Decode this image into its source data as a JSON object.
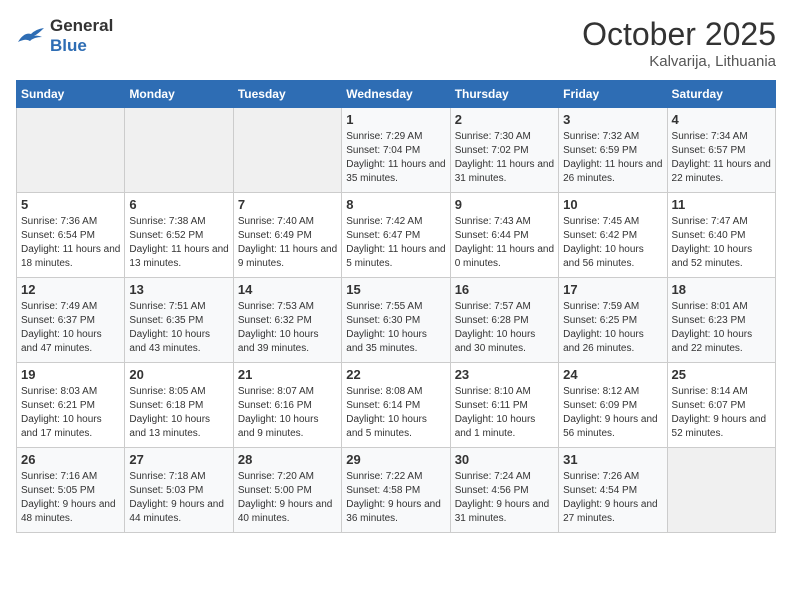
{
  "header": {
    "logo_general": "General",
    "logo_blue": "Blue",
    "month": "October 2025",
    "location": "Kalvarija, Lithuania"
  },
  "days_of_week": [
    "Sunday",
    "Monday",
    "Tuesday",
    "Wednesday",
    "Thursday",
    "Friday",
    "Saturday"
  ],
  "weeks": [
    [
      {
        "day": "",
        "sunrise": "",
        "sunset": "",
        "daylight": ""
      },
      {
        "day": "",
        "sunrise": "",
        "sunset": "",
        "daylight": ""
      },
      {
        "day": "",
        "sunrise": "",
        "sunset": "",
        "daylight": ""
      },
      {
        "day": "1",
        "sunrise": "Sunrise: 7:29 AM",
        "sunset": "Sunset: 7:04 PM",
        "daylight": "Daylight: 11 hours and 35 minutes."
      },
      {
        "day": "2",
        "sunrise": "Sunrise: 7:30 AM",
        "sunset": "Sunset: 7:02 PM",
        "daylight": "Daylight: 11 hours and 31 minutes."
      },
      {
        "day": "3",
        "sunrise": "Sunrise: 7:32 AM",
        "sunset": "Sunset: 6:59 PM",
        "daylight": "Daylight: 11 hours and 26 minutes."
      },
      {
        "day": "4",
        "sunrise": "Sunrise: 7:34 AM",
        "sunset": "Sunset: 6:57 PM",
        "daylight": "Daylight: 11 hours and 22 minutes."
      }
    ],
    [
      {
        "day": "5",
        "sunrise": "Sunrise: 7:36 AM",
        "sunset": "Sunset: 6:54 PM",
        "daylight": "Daylight: 11 hours and 18 minutes."
      },
      {
        "day": "6",
        "sunrise": "Sunrise: 7:38 AM",
        "sunset": "Sunset: 6:52 PM",
        "daylight": "Daylight: 11 hours and 13 minutes."
      },
      {
        "day": "7",
        "sunrise": "Sunrise: 7:40 AM",
        "sunset": "Sunset: 6:49 PM",
        "daylight": "Daylight: 11 hours and 9 minutes."
      },
      {
        "day": "8",
        "sunrise": "Sunrise: 7:42 AM",
        "sunset": "Sunset: 6:47 PM",
        "daylight": "Daylight: 11 hours and 5 minutes."
      },
      {
        "day": "9",
        "sunrise": "Sunrise: 7:43 AM",
        "sunset": "Sunset: 6:44 PM",
        "daylight": "Daylight: 11 hours and 0 minutes."
      },
      {
        "day": "10",
        "sunrise": "Sunrise: 7:45 AM",
        "sunset": "Sunset: 6:42 PM",
        "daylight": "Daylight: 10 hours and 56 minutes."
      },
      {
        "day": "11",
        "sunrise": "Sunrise: 7:47 AM",
        "sunset": "Sunset: 6:40 PM",
        "daylight": "Daylight: 10 hours and 52 minutes."
      }
    ],
    [
      {
        "day": "12",
        "sunrise": "Sunrise: 7:49 AM",
        "sunset": "Sunset: 6:37 PM",
        "daylight": "Daylight: 10 hours and 47 minutes."
      },
      {
        "day": "13",
        "sunrise": "Sunrise: 7:51 AM",
        "sunset": "Sunset: 6:35 PM",
        "daylight": "Daylight: 10 hours and 43 minutes."
      },
      {
        "day": "14",
        "sunrise": "Sunrise: 7:53 AM",
        "sunset": "Sunset: 6:32 PM",
        "daylight": "Daylight: 10 hours and 39 minutes."
      },
      {
        "day": "15",
        "sunrise": "Sunrise: 7:55 AM",
        "sunset": "Sunset: 6:30 PM",
        "daylight": "Daylight: 10 hours and 35 minutes."
      },
      {
        "day": "16",
        "sunrise": "Sunrise: 7:57 AM",
        "sunset": "Sunset: 6:28 PM",
        "daylight": "Daylight: 10 hours and 30 minutes."
      },
      {
        "day": "17",
        "sunrise": "Sunrise: 7:59 AM",
        "sunset": "Sunset: 6:25 PM",
        "daylight": "Daylight: 10 hours and 26 minutes."
      },
      {
        "day": "18",
        "sunrise": "Sunrise: 8:01 AM",
        "sunset": "Sunset: 6:23 PM",
        "daylight": "Daylight: 10 hours and 22 minutes."
      }
    ],
    [
      {
        "day": "19",
        "sunrise": "Sunrise: 8:03 AM",
        "sunset": "Sunset: 6:21 PM",
        "daylight": "Daylight: 10 hours and 17 minutes."
      },
      {
        "day": "20",
        "sunrise": "Sunrise: 8:05 AM",
        "sunset": "Sunset: 6:18 PM",
        "daylight": "Daylight: 10 hours and 13 minutes."
      },
      {
        "day": "21",
        "sunrise": "Sunrise: 8:07 AM",
        "sunset": "Sunset: 6:16 PM",
        "daylight": "Daylight: 10 hours and 9 minutes."
      },
      {
        "day": "22",
        "sunrise": "Sunrise: 8:08 AM",
        "sunset": "Sunset: 6:14 PM",
        "daylight": "Daylight: 10 hours and 5 minutes."
      },
      {
        "day": "23",
        "sunrise": "Sunrise: 8:10 AM",
        "sunset": "Sunset: 6:11 PM",
        "daylight": "Daylight: 10 hours and 1 minute."
      },
      {
        "day": "24",
        "sunrise": "Sunrise: 8:12 AM",
        "sunset": "Sunset: 6:09 PM",
        "daylight": "Daylight: 9 hours and 56 minutes."
      },
      {
        "day": "25",
        "sunrise": "Sunrise: 8:14 AM",
        "sunset": "Sunset: 6:07 PM",
        "daylight": "Daylight: 9 hours and 52 minutes."
      }
    ],
    [
      {
        "day": "26",
        "sunrise": "Sunrise: 7:16 AM",
        "sunset": "Sunset: 5:05 PM",
        "daylight": "Daylight: 9 hours and 48 minutes."
      },
      {
        "day": "27",
        "sunrise": "Sunrise: 7:18 AM",
        "sunset": "Sunset: 5:03 PM",
        "daylight": "Daylight: 9 hours and 44 minutes."
      },
      {
        "day": "28",
        "sunrise": "Sunrise: 7:20 AM",
        "sunset": "Sunset: 5:00 PM",
        "daylight": "Daylight: 9 hours and 40 minutes."
      },
      {
        "day": "29",
        "sunrise": "Sunrise: 7:22 AM",
        "sunset": "Sunset: 4:58 PM",
        "daylight": "Daylight: 9 hours and 36 minutes."
      },
      {
        "day": "30",
        "sunrise": "Sunrise: 7:24 AM",
        "sunset": "Sunset: 4:56 PM",
        "daylight": "Daylight: 9 hours and 31 minutes."
      },
      {
        "day": "31",
        "sunrise": "Sunrise: 7:26 AM",
        "sunset": "Sunset: 4:54 PM",
        "daylight": "Daylight: 9 hours and 27 minutes."
      },
      {
        "day": "",
        "sunrise": "",
        "sunset": "",
        "daylight": ""
      }
    ]
  ]
}
